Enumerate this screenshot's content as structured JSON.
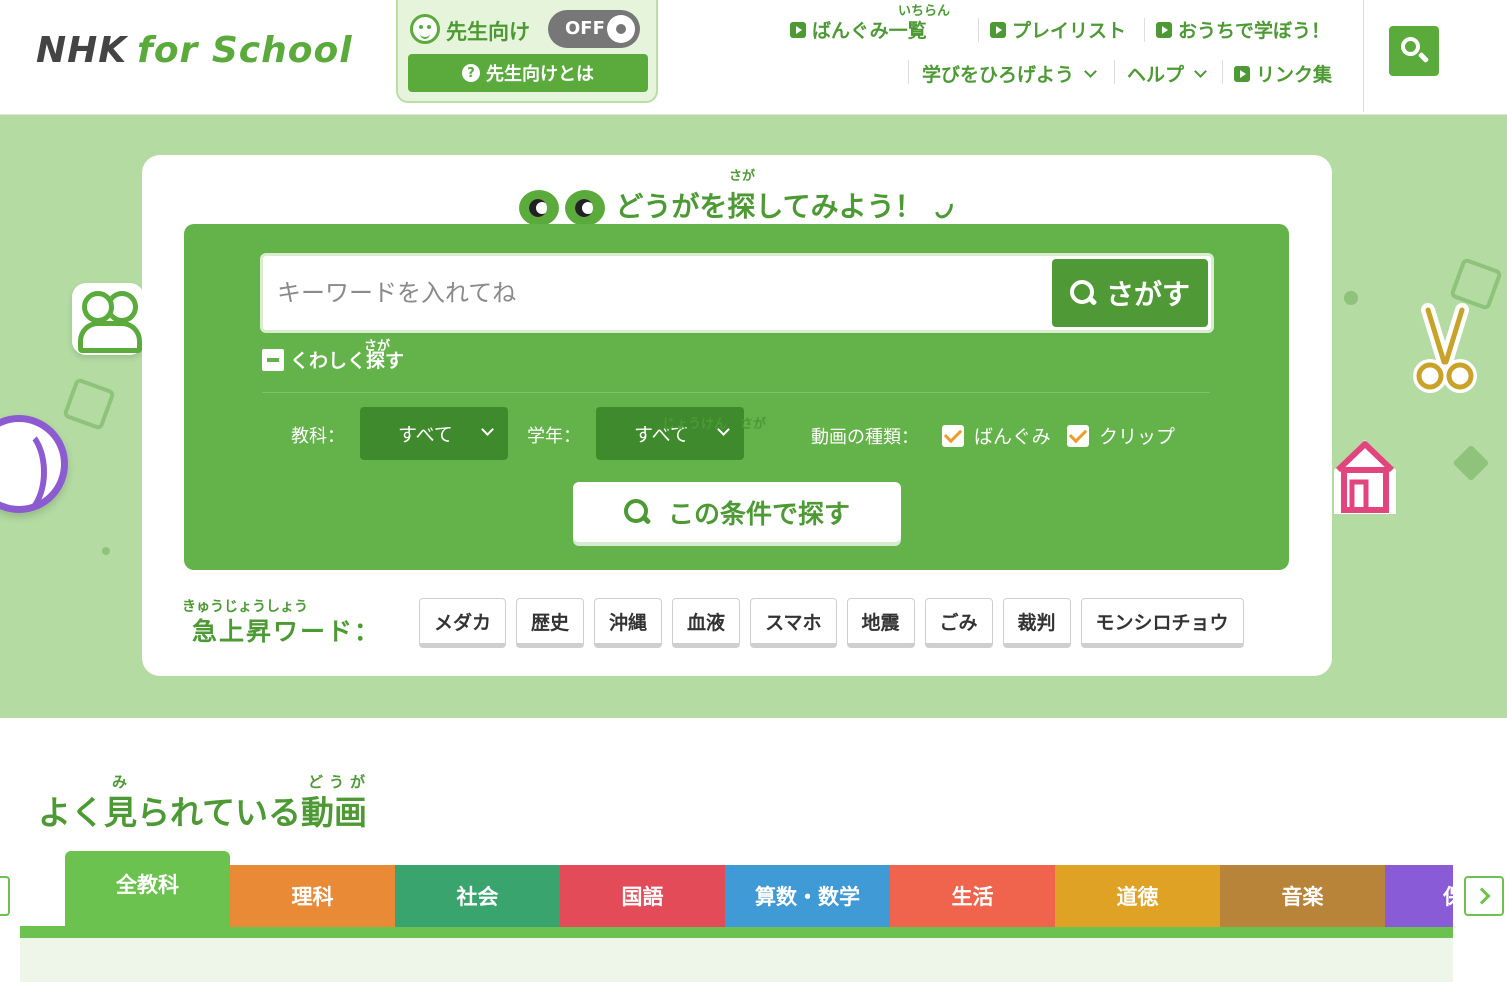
{
  "header": {
    "logo": {
      "nhk": "NHK",
      "for_school": "for School"
    },
    "teacher": {
      "label": "先生向け",
      "toggle": "OFF",
      "about": "先生向けとは"
    },
    "nav_top": [
      {
        "label": "ばんぐみ一覧",
        "ruby": "いちらん"
      },
      {
        "label": "プレイリスト"
      },
      {
        "label": "おうちで学ぼう！"
      }
    ],
    "nav_bottom": [
      {
        "label": "学びをひろげよう"
      },
      {
        "label": "ヘルプ"
      },
      {
        "label": "リンク集"
      }
    ]
  },
  "search": {
    "title": "どうがを探してみよう！",
    "title_ruby": "さが",
    "placeholder": "キーワードを入れてね",
    "submit": "さがす",
    "detail_toggle": "くわしく探す",
    "detail_ruby": "さが",
    "filters": {
      "subject_label": "教科：",
      "subject_value": "すべて",
      "grade_label": "学年：",
      "grade_value": "すべて",
      "type_label": "動画の種類：",
      "type_options": [
        "ばんぐみ",
        "クリップ"
      ]
    },
    "condition_button": "この条件で探す",
    "condition_ruby": "じょうけん　さが",
    "trending_label": "急上昇ワード：",
    "trending_ruby": "きゅうじょうしょう",
    "trending_words": [
      "メダカ",
      "歴史",
      "沖縄",
      "血液",
      "スマホ",
      "地震",
      "ごみ",
      "裁判",
      "モンシロチョウ"
    ]
  },
  "popular": {
    "title": "よく見られている動画",
    "ruby_mi": "み",
    "ruby_douga": "どうが",
    "tabs": [
      {
        "label": "全教科",
        "color": "#6cc24f"
      },
      {
        "label": "理科",
        "color": "#e88a36"
      },
      {
        "label": "社会",
        "color": "#3aa46e"
      },
      {
        "label": "国語",
        "color": "#e24b57"
      },
      {
        "label": "算数・数学",
        "color": "#3f9ad6"
      },
      {
        "label": "生活",
        "color": "#f0644e"
      },
      {
        "label": "道徳",
        "color": "#e0a224"
      },
      {
        "label": "音楽",
        "color": "#b8843a"
      },
      {
        "label": "保健",
        "color": "#8a5bd6"
      }
    ]
  }
}
